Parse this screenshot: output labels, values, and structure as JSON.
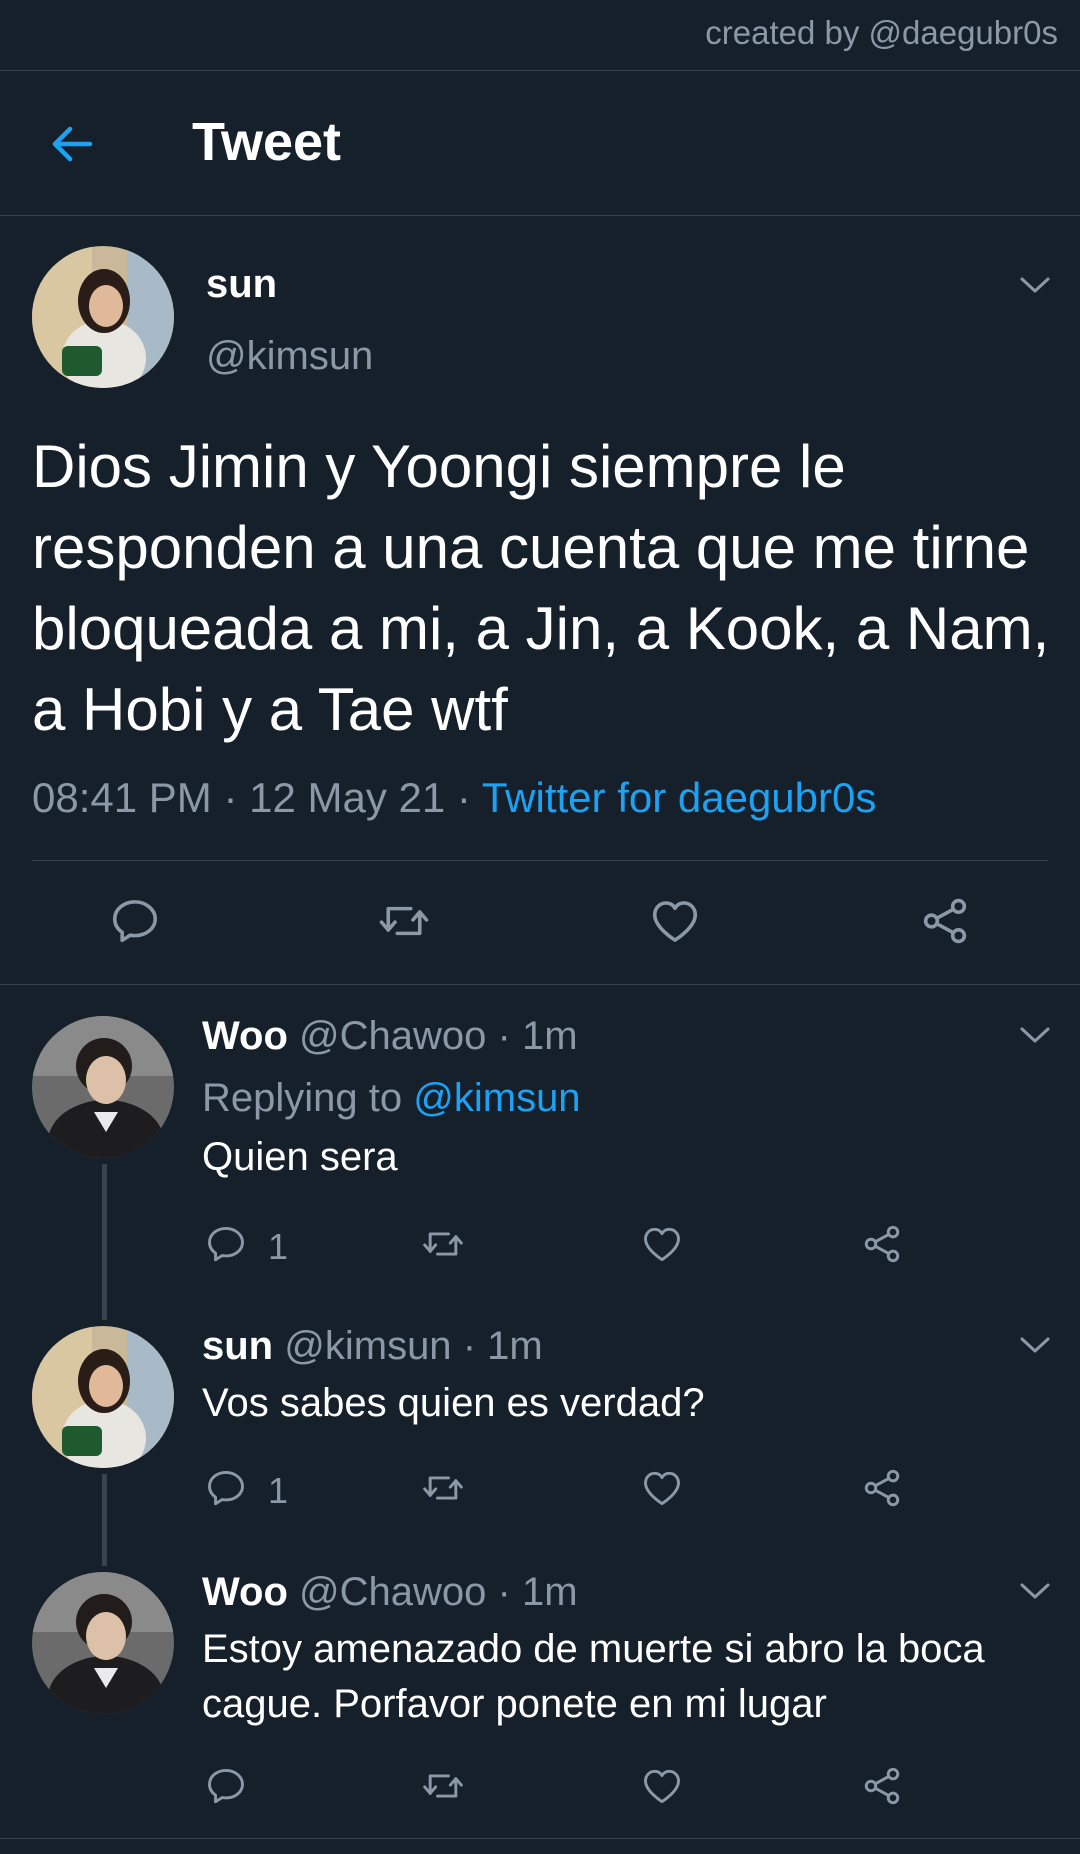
{
  "watermark": "created by @daegubr0s",
  "header": {
    "title": "Tweet",
    "back_icon": "arrow-left-icon"
  },
  "colors": {
    "background": "#15202b",
    "accent": "#1da1f2",
    "muted": "#8b98a5",
    "divider": "#38444d"
  },
  "main_tweet": {
    "name": "sun",
    "handle": "@kimsun",
    "text": "Dios Jimin y Yoongi siempre le responden a una cuenta que me tirne bloqueada a mi, a Jin, a Kook, a Nam, a Hobi y a Tae wtf",
    "time": "08:41 PM",
    "date": "12 May 21",
    "source": "Twitter for daegubr0s",
    "sep": "·"
  },
  "replies": [
    {
      "name": "Woo",
      "handle": "@Chawoo",
      "time": "1m",
      "replying_label": "Replying to",
      "replying_to": "@kimsun",
      "text": "Quien sera",
      "reply_count": "1"
    },
    {
      "name": "sun",
      "handle": "@kimsun",
      "time": "1m",
      "text": "Vos sabes quien es verdad?",
      "reply_count": "1"
    },
    {
      "name": "Woo",
      "handle": "@Chawoo",
      "time": "1m",
      "text": "Estoy amenazado de muerte si abro la boca cague. Porfavor ponete en mi lugar",
      "reply_count": ""
    }
  ]
}
